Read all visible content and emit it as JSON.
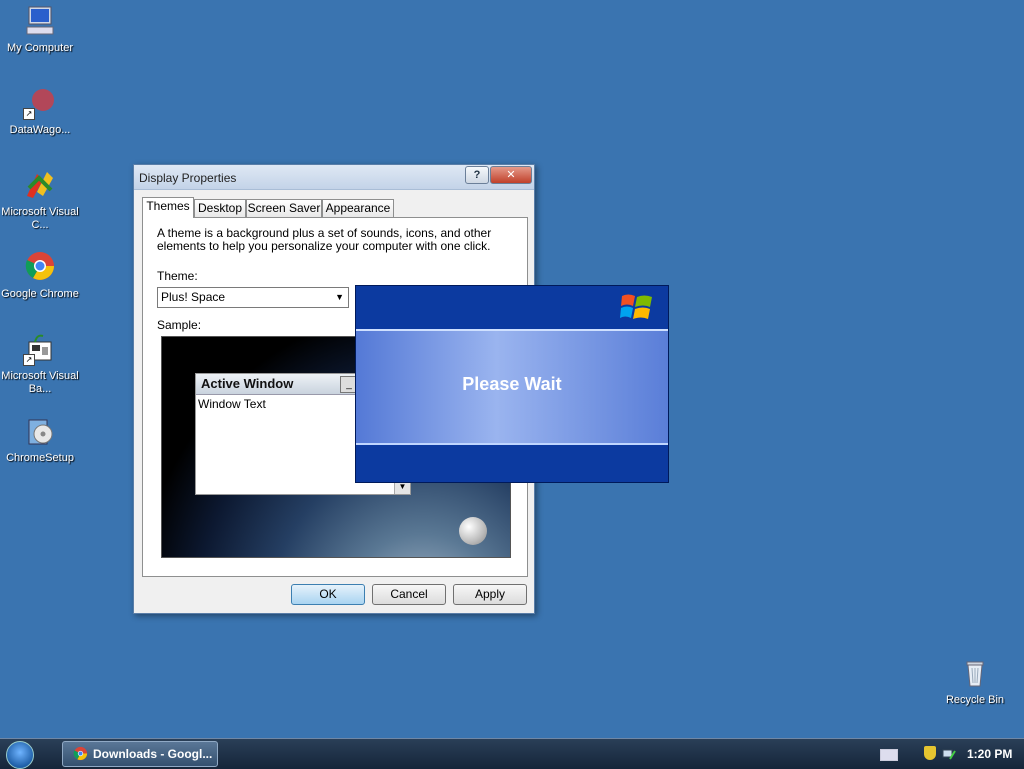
{
  "desktop": {
    "icons": [
      {
        "label": "My Computer"
      },
      {
        "label": "DataWago..."
      },
      {
        "label": "Microsoft Visual C..."
      },
      {
        "label": "Google Chrome"
      },
      {
        "label": "Microsoft Visual Ba..."
      },
      {
        "label": "ChromeSetup"
      },
      {
        "label": "Recycle Bin"
      }
    ]
  },
  "dialog": {
    "title": "Display Properties",
    "help_glyph": "?",
    "close_glyph": "✕",
    "tabs": [
      {
        "label": "Themes"
      },
      {
        "label": "Desktop"
      },
      {
        "label": "Screen Saver"
      },
      {
        "label": "Appearance"
      }
    ],
    "description": "A theme is a background plus a set of sounds, icons, and other elements to help you personalize your computer with one click.",
    "theme_label": "Theme:",
    "theme_value": "Plus! Space",
    "sample_label": "Sample:",
    "sample_window_title": "Active Window",
    "sample_window_text": "Window Text",
    "buttons": {
      "ok": "OK",
      "cancel": "Cancel",
      "apply": "Apply"
    }
  },
  "please_wait": {
    "message": "Please Wait"
  },
  "taskbar": {
    "task_label": "Downloads - Googl...",
    "clock": "1:20 PM"
  },
  "colors": {
    "desktop": "#3a74b0",
    "wait_dark": "#0c3aa0",
    "wait_mid": "#9ab4ef"
  }
}
